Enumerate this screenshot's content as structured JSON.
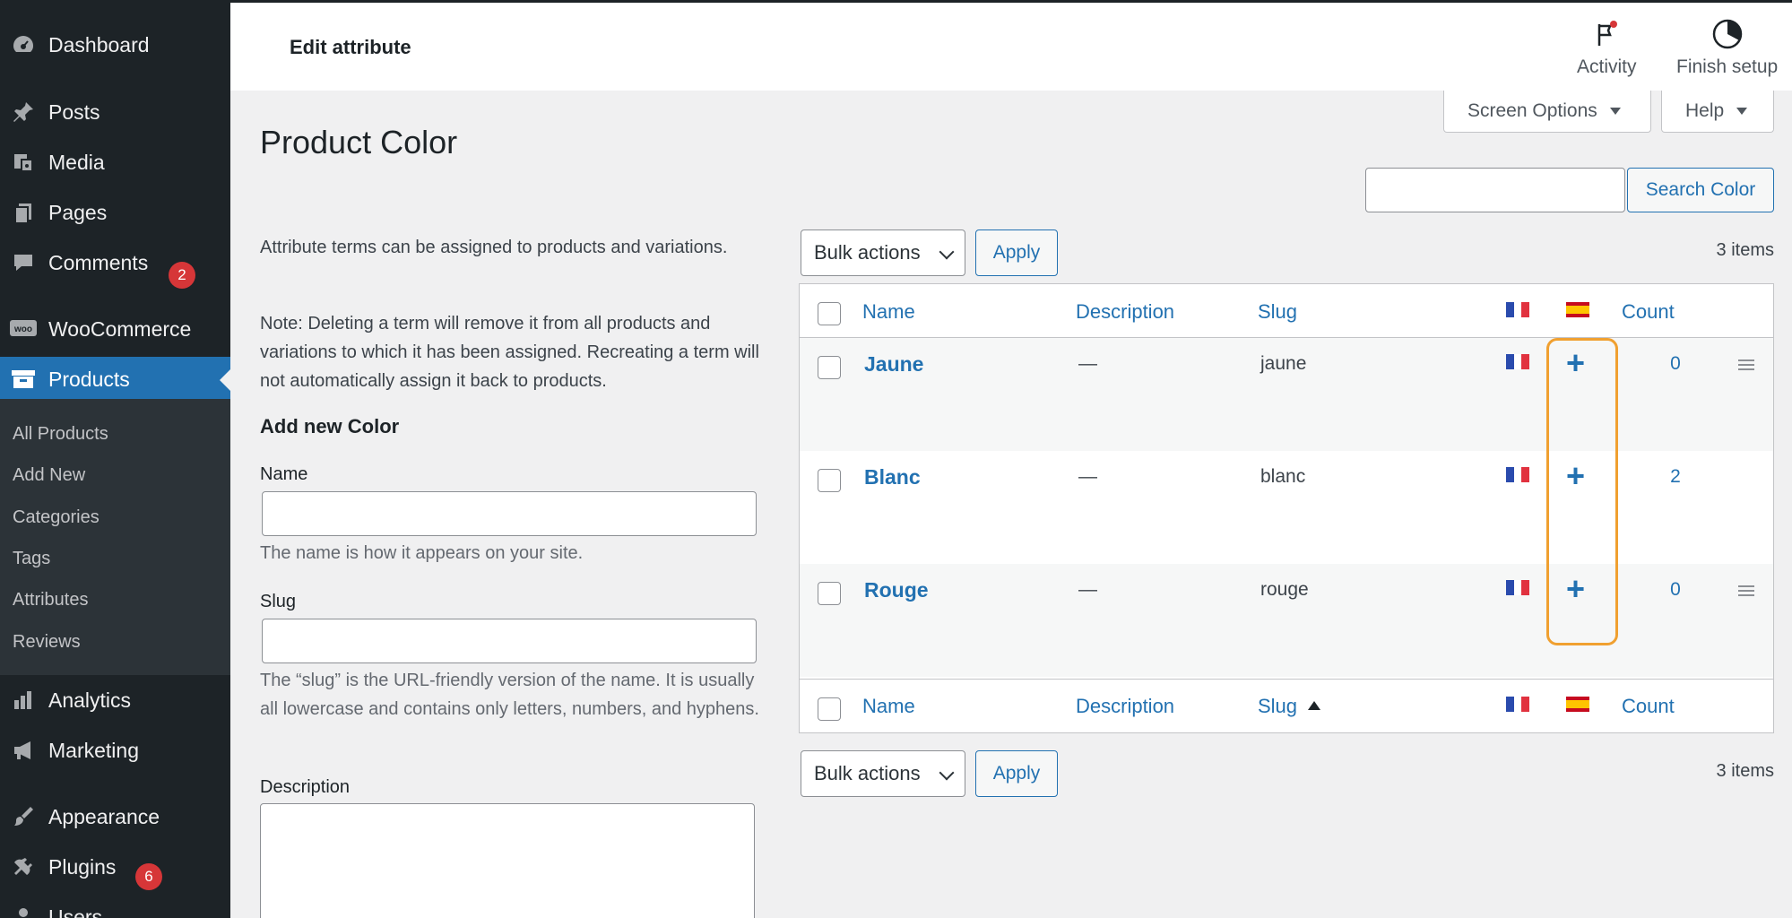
{
  "sidebar": {
    "items": [
      {
        "label": "Dashboard",
        "icon": "dashboard-icon"
      },
      {
        "label": "Posts",
        "icon": "pin-icon"
      },
      {
        "label": "Media",
        "icon": "media-icon"
      },
      {
        "label": "Pages",
        "icon": "pages-icon"
      },
      {
        "label": "Comments",
        "icon": "comment-icon",
        "badge": "2"
      },
      {
        "label": "WooCommerce",
        "icon": "woo-icon"
      },
      {
        "label": "Products",
        "icon": "archive-icon",
        "active": true
      },
      {
        "label": "Analytics",
        "icon": "bar-chart-icon"
      },
      {
        "label": "Marketing",
        "icon": "megaphone-icon"
      },
      {
        "label": "Appearance",
        "icon": "brush-icon"
      },
      {
        "label": "Plugins",
        "icon": "plug-icon",
        "badge": "6"
      },
      {
        "label": "Users",
        "icon": "user-icon"
      }
    ],
    "submenu": [
      "All Products",
      "Add New",
      "Categories",
      "Tags",
      "Attributes",
      "Reviews"
    ]
  },
  "topbar": {
    "title": "Edit attribute",
    "activity": "Activity",
    "finish_setup": "Finish setup"
  },
  "screen_options": "Screen Options",
  "help": "Help",
  "page_title": "Product Color",
  "search": {
    "button": "Search Color",
    "value": ""
  },
  "left": {
    "intro": "Attribute terms can be assigned to products and variations.",
    "note": "Note: Deleting a term will remove it from all products and variations to which it has been assigned. Recreating a term will not automatically assign it back to products.",
    "add_heading": "Add new Color",
    "name_label": "Name",
    "name_help": "The name is how it appears on your site.",
    "slug_label": "Slug",
    "slug_help": "The “slug” is the URL-friendly version of the name. It is usually all lowercase and contains only letters, numbers, and hyphens.",
    "description_label": "Description"
  },
  "table": {
    "bulk_actions": "Bulk actions",
    "apply": "Apply",
    "items_count": "3 items",
    "columns": {
      "name": "Name",
      "description": "Description",
      "slug": "Slug",
      "count": "Count"
    },
    "rows": [
      {
        "name": "Jaune",
        "description": "—",
        "slug": "jaune",
        "translation": "+",
        "count": "0"
      },
      {
        "name": "Blanc",
        "description": "—",
        "slug": "blanc",
        "translation": "+",
        "count": "2"
      },
      {
        "name": "Rouge",
        "description": "—",
        "slug": "rouge",
        "translation": "+",
        "count": "0"
      }
    ]
  },
  "colors": {
    "accent": "#2271b1",
    "sidebar": "#1d2327",
    "highlight": "#f0a030",
    "badge": "#d63638"
  }
}
